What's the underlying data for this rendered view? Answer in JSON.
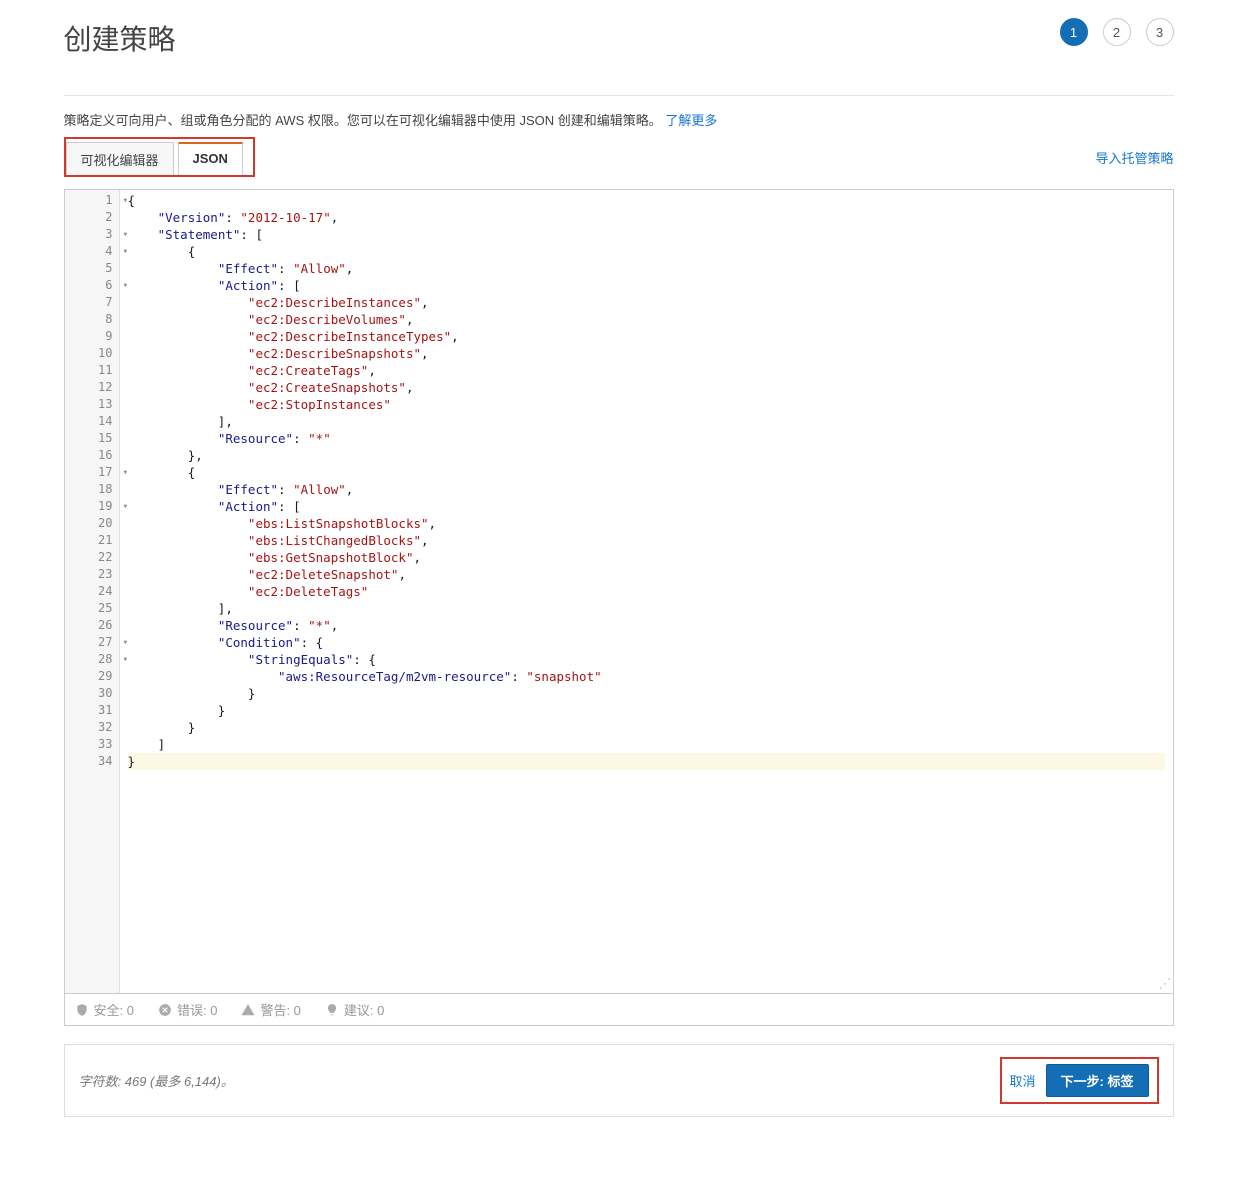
{
  "header": {
    "title": "创建策略",
    "steps": [
      "1",
      "2",
      "3"
    ],
    "activeStep": 0
  },
  "desc": {
    "text": "策略定义可向用户、组或角色分配的 AWS 权限。您可以在可视化编辑器中使用 JSON 创建和编辑策略。",
    "link": "了解更多"
  },
  "tabs": {
    "visual": "可视化编辑器",
    "json": "JSON",
    "active": "json",
    "import": "导入托管策略"
  },
  "code": {
    "lines": [
      {
        "n": 1,
        "f": 1,
        "t": [
          [
            "",
            "{"
          ]
        ]
      },
      {
        "n": 2,
        "f": 0,
        "t": [
          [
            "",
            "    "
          ],
          [
            "k",
            "\"Version\""
          ],
          [
            "",
            ": "
          ],
          [
            "s",
            "\"2012-10-17\""
          ],
          [
            "",
            ","
          ]
        ]
      },
      {
        "n": 3,
        "f": 1,
        "t": [
          [
            "",
            "    "
          ],
          [
            "k",
            "\"Statement\""
          ],
          [
            "",
            ": ["
          ]
        ]
      },
      {
        "n": 4,
        "f": 1,
        "t": [
          [
            "",
            "        {"
          ]
        ]
      },
      {
        "n": 5,
        "f": 0,
        "t": [
          [
            "",
            "            "
          ],
          [
            "k",
            "\"Effect\""
          ],
          [
            "",
            ": "
          ],
          [
            "s",
            "\"Allow\""
          ],
          [
            "",
            ","
          ]
        ]
      },
      {
        "n": 6,
        "f": 1,
        "t": [
          [
            "",
            "            "
          ],
          [
            "k",
            "\"Action\""
          ],
          [
            "",
            ": ["
          ]
        ]
      },
      {
        "n": 7,
        "f": 0,
        "t": [
          [
            "",
            "                "
          ],
          [
            "s",
            "\"ec2:DescribeInstances\""
          ],
          [
            "",
            ","
          ]
        ]
      },
      {
        "n": 8,
        "f": 0,
        "t": [
          [
            "",
            "                "
          ],
          [
            "s",
            "\"ec2:DescribeVolumes\""
          ],
          [
            "",
            ","
          ]
        ]
      },
      {
        "n": 9,
        "f": 0,
        "t": [
          [
            "",
            "                "
          ],
          [
            "s",
            "\"ec2:DescribeInstanceTypes\""
          ],
          [
            "",
            ","
          ]
        ]
      },
      {
        "n": 10,
        "f": 0,
        "t": [
          [
            "",
            "                "
          ],
          [
            "s",
            "\"ec2:DescribeSnapshots\""
          ],
          [
            "",
            ","
          ]
        ]
      },
      {
        "n": 11,
        "f": 0,
        "t": [
          [
            "",
            "                "
          ],
          [
            "s",
            "\"ec2:CreateTags\""
          ],
          [
            "",
            ","
          ]
        ]
      },
      {
        "n": 12,
        "f": 0,
        "t": [
          [
            "",
            "                "
          ],
          [
            "s",
            "\"ec2:CreateSnapshots\""
          ],
          [
            "",
            ","
          ]
        ]
      },
      {
        "n": 13,
        "f": 0,
        "t": [
          [
            "",
            "                "
          ],
          [
            "s",
            "\"ec2:StopInstances\""
          ]
        ]
      },
      {
        "n": 14,
        "f": 0,
        "t": [
          [
            "",
            "            ],"
          ]
        ]
      },
      {
        "n": 15,
        "f": 0,
        "t": [
          [
            "",
            "            "
          ],
          [
            "k",
            "\"Resource\""
          ],
          [
            "",
            ": "
          ],
          [
            "s",
            "\"*\""
          ]
        ]
      },
      {
        "n": 16,
        "f": 0,
        "t": [
          [
            "",
            "        },"
          ]
        ]
      },
      {
        "n": 17,
        "f": 1,
        "t": [
          [
            "",
            "        {"
          ]
        ]
      },
      {
        "n": 18,
        "f": 0,
        "t": [
          [
            "",
            "            "
          ],
          [
            "k",
            "\"Effect\""
          ],
          [
            "",
            ": "
          ],
          [
            "s",
            "\"Allow\""
          ],
          [
            "",
            ","
          ]
        ]
      },
      {
        "n": 19,
        "f": 1,
        "t": [
          [
            "",
            "            "
          ],
          [
            "k",
            "\"Action\""
          ],
          [
            "",
            ": ["
          ]
        ]
      },
      {
        "n": 20,
        "f": 0,
        "t": [
          [
            "",
            "                "
          ],
          [
            "s",
            "\"ebs:ListSnapshotBlocks\""
          ],
          [
            "",
            ","
          ]
        ]
      },
      {
        "n": 21,
        "f": 0,
        "t": [
          [
            "",
            "                "
          ],
          [
            "s",
            "\"ebs:ListChangedBlocks\""
          ],
          [
            "",
            ","
          ]
        ]
      },
      {
        "n": 22,
        "f": 0,
        "t": [
          [
            "",
            "                "
          ],
          [
            "s",
            "\"ebs:GetSnapshotBlock\""
          ],
          [
            "",
            ","
          ]
        ]
      },
      {
        "n": 23,
        "f": 0,
        "t": [
          [
            "",
            "                "
          ],
          [
            "s",
            "\"ec2:DeleteSnapshot\""
          ],
          [
            "",
            ","
          ]
        ]
      },
      {
        "n": 24,
        "f": 0,
        "t": [
          [
            "",
            "                "
          ],
          [
            "s",
            "\"ec2:DeleteTags\""
          ]
        ]
      },
      {
        "n": 25,
        "f": 0,
        "t": [
          [
            "",
            "            ],"
          ]
        ]
      },
      {
        "n": 26,
        "f": 0,
        "t": [
          [
            "",
            "            "
          ],
          [
            "k",
            "\"Resource\""
          ],
          [
            "",
            ": "
          ],
          [
            "s",
            "\"*\""
          ],
          [
            "",
            ","
          ]
        ]
      },
      {
        "n": 27,
        "f": 1,
        "t": [
          [
            "",
            "            "
          ],
          [
            "k",
            "\"Condition\""
          ],
          [
            "",
            ": {"
          ]
        ]
      },
      {
        "n": 28,
        "f": 1,
        "t": [
          [
            "",
            "                "
          ],
          [
            "k",
            "\"StringEquals\""
          ],
          [
            "",
            ": {"
          ]
        ]
      },
      {
        "n": 29,
        "f": 0,
        "t": [
          [
            "",
            "                    "
          ],
          [
            "k",
            "\"aws:ResourceTag/m2vm-resource\""
          ],
          [
            "",
            ": "
          ],
          [
            "s",
            "\"snapshot\""
          ]
        ]
      },
      {
        "n": 30,
        "f": 0,
        "t": [
          [
            "",
            "                }"
          ]
        ]
      },
      {
        "n": 31,
        "f": 0,
        "t": [
          [
            "",
            "            }"
          ]
        ]
      },
      {
        "n": 32,
        "f": 0,
        "t": [
          [
            "",
            "        }"
          ]
        ]
      },
      {
        "n": 33,
        "f": 0,
        "t": [
          [
            "",
            "    ]"
          ]
        ]
      },
      {
        "n": 34,
        "f": 0,
        "hl": 1,
        "t": [
          [
            "",
            "}"
          ]
        ]
      }
    ]
  },
  "status": {
    "security": "安全: 0",
    "errors": "错误: 0",
    "warnings": "警告: 0",
    "suggestions": "建议: 0"
  },
  "footer": {
    "chars": "字符数: 469 (最多 6,144)。",
    "cancel": "取消",
    "next": "下一步: 标签"
  }
}
